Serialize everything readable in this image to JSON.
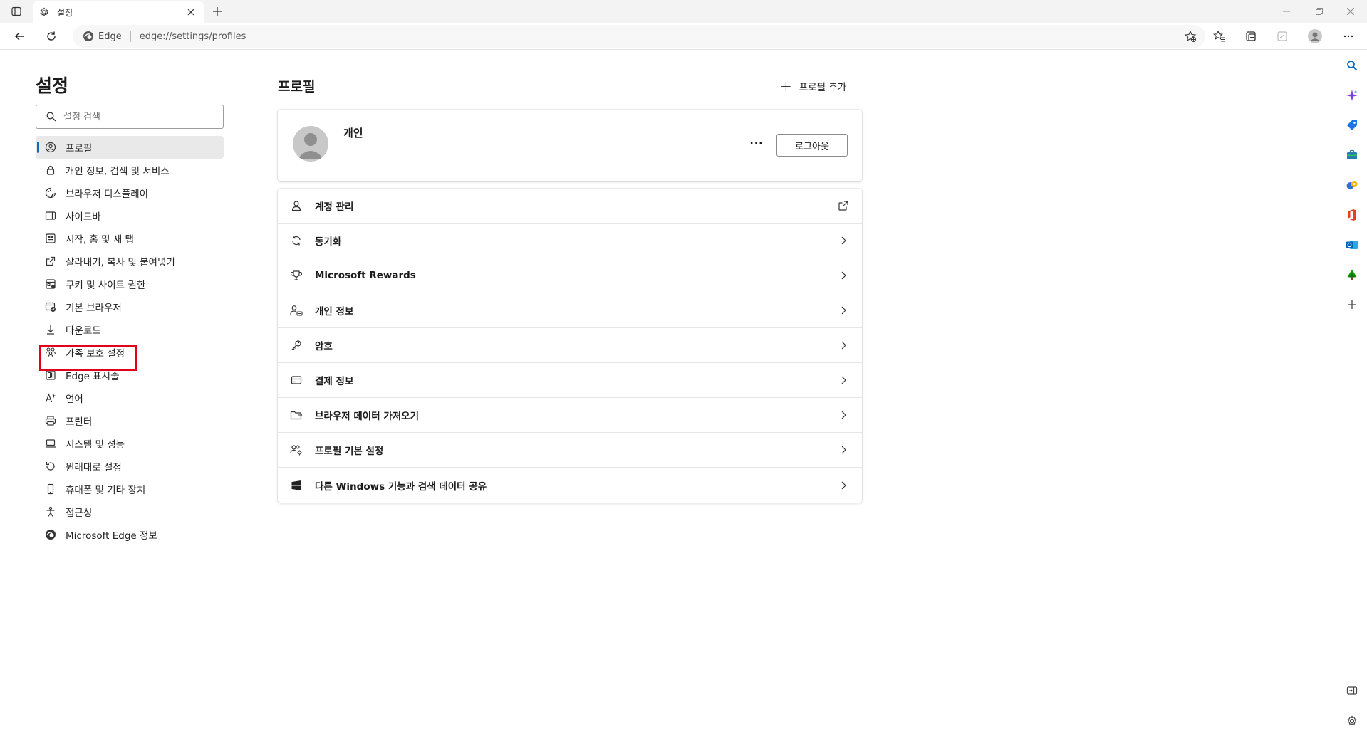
{
  "tab": {
    "title": "설정"
  },
  "address": {
    "site_label": "Edge",
    "url": "edge://settings/profiles"
  },
  "leftnav": {
    "title": "설정",
    "search_placeholder": "설정 검색",
    "items": [
      {
        "label": "프로필",
        "icon": "profile-icon"
      },
      {
        "label": "개인 정보, 검색 및 서비스",
        "icon": "lock-icon"
      },
      {
        "label": "브라우저 디스플레이",
        "icon": "appearance-icon"
      },
      {
        "label": "사이드바",
        "icon": "sidebar-icon"
      },
      {
        "label": "시작, 홈 및 새 탭",
        "icon": "start-icon"
      },
      {
        "label": "잘라내기, 복사 및 붙여넣기",
        "icon": "share-icon"
      },
      {
        "label": "쿠키 및 사이트 권한",
        "icon": "cookie-icon"
      },
      {
        "label": "기본 브라우저",
        "icon": "default-browser-icon"
      },
      {
        "label": "다운로드",
        "icon": "download-icon"
      },
      {
        "label": "가족 보호 설정",
        "icon": "family-icon"
      },
      {
        "label": "Edge 표시줄",
        "icon": "edge-bar-icon"
      },
      {
        "label": "언어",
        "icon": "language-icon"
      },
      {
        "label": "프린터",
        "icon": "printer-icon"
      },
      {
        "label": "시스템 및 성능",
        "icon": "laptop-icon"
      },
      {
        "label": "원래대로 설정",
        "icon": "reset-icon"
      },
      {
        "label": "휴대폰 및 기타 장치",
        "icon": "phone-icon"
      },
      {
        "label": "접근성",
        "icon": "accessibility-icon"
      },
      {
        "label": "Microsoft Edge 정보",
        "icon": "edge-logo-icon"
      }
    ]
  },
  "main": {
    "title": "프로필",
    "add_profile": "프로필 추가",
    "profile": {
      "name": "개인",
      "more": "···",
      "logout": "로그아웃"
    },
    "rows": [
      {
        "label": "계정 관리",
        "icon": "person-icon",
        "trail": "external-link-icon"
      },
      {
        "label": "동기화",
        "icon": "sync-icon",
        "trail": "chevron-right-icon"
      },
      {
        "label": "Microsoft Rewards",
        "icon": "trophy-icon",
        "trail": "chevron-right-icon"
      },
      {
        "label": "개인 정보",
        "icon": "person-info-icon",
        "trail": "chevron-right-icon"
      },
      {
        "label": "암호",
        "icon": "key-icon",
        "trail": "chevron-right-icon"
      },
      {
        "label": "결제 정보",
        "icon": "card-icon",
        "trail": "chevron-right-icon"
      },
      {
        "label": "브라우저 데이터 가져오기",
        "icon": "import-icon",
        "trail": "chevron-right-icon"
      },
      {
        "label": "프로필 기본 설정",
        "icon": "people-settings-icon",
        "trail": "chevron-right-icon"
      },
      {
        "label": "다른 Windows 기능과 검색 데이터 공유",
        "icon": "windows-icon",
        "trail": "chevron-right-icon"
      }
    ]
  },
  "colors": {
    "accent": "#0f6cbd",
    "highlight": "#e0001b"
  }
}
